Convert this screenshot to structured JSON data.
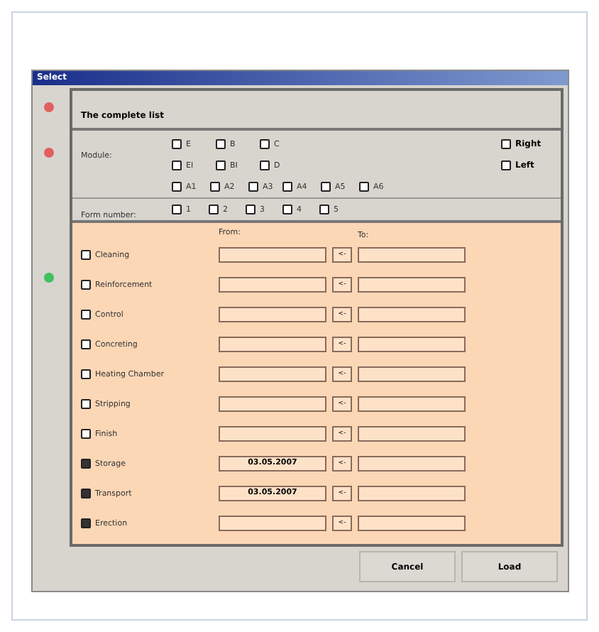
{
  "window": {
    "title": "Select"
  },
  "list_section": {
    "title": "The complete list",
    "color": "#e06060"
  },
  "module_section": {
    "label": "Module:",
    "color": "#e06060",
    "rows": [
      [
        {
          "label": "E",
          "checked": false
        },
        {
          "label": "B",
          "checked": false
        },
        {
          "label": "C",
          "checked": false
        }
      ],
      [
        {
          "label": "EI",
          "checked": false
        },
        {
          "label": "BI",
          "checked": false
        },
        {
          "label": "D",
          "checked": false
        }
      ],
      [
        {
          "label": "A1",
          "checked": false
        },
        {
          "label": "A2",
          "checked": false
        },
        {
          "label": "A3",
          "checked": false
        },
        {
          "label": "A4",
          "checked": false
        },
        {
          "label": "A5",
          "checked": false
        },
        {
          "label": "A6",
          "checked": false
        }
      ]
    ],
    "sides": [
      {
        "label": "Right",
        "checked": false
      },
      {
        "label": "Left",
        "checked": false
      }
    ]
  },
  "form_number": {
    "label": "Form number:",
    "options": [
      {
        "label": "1",
        "checked": false
      },
      {
        "label": "2",
        "checked": false
      },
      {
        "label": "3",
        "checked": false
      },
      {
        "label": "4",
        "checked": false
      },
      {
        "label": "5",
        "checked": false
      }
    ]
  },
  "steps_section": {
    "color": "#40c060",
    "from_label": "From:",
    "to_label": "To:",
    "steps": [
      {
        "label": "Cleaning",
        "checked": false,
        "copy": "<-"
      },
      {
        "label": "Reinforcement",
        "checked": false,
        "copy": "<-"
      },
      {
        "label": "Control",
        "checked": false,
        "copy": "<-"
      },
      {
        "label": "Concreting",
        "checked": false,
        "copy": "<-"
      },
      {
        "label": "Heating Chamber",
        "checked": false,
        "copy": "<-"
      },
      {
        "label": "Stripping",
        "checked": false,
        "copy": "<-"
      },
      {
        "label": "Finish",
        "checked": false,
        "copy": "<-"
      },
      {
        "label": "Storage",
        "checked": true,
        "from": "03.05.2007",
        "copy": "<-"
      },
      {
        "label": "Transport",
        "checked": true,
        "from": "03.05.2007",
        "copy": "<-"
      },
      {
        "label": "Erection",
        "checked": true,
        "copy": "<-"
      }
    ]
  },
  "buttons": [
    "Cancel",
    "Load"
  ]
}
